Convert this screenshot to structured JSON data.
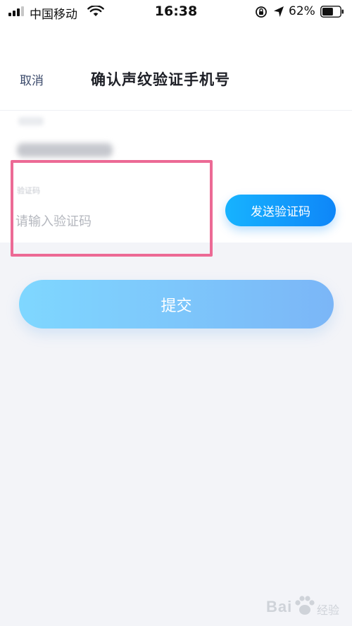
{
  "status_bar": {
    "carrier": "中国移动",
    "time": "16:38",
    "battery_percent": "62%",
    "battery_level": 0.62,
    "icons": [
      "signal-icon",
      "wifi-icon",
      "orientation-lock-icon",
      "location-arrow-icon",
      "battery-icon"
    ]
  },
  "nav": {
    "cancel_label": "取消",
    "title": "确认声纹验证手机号"
  },
  "form": {
    "code_label": "验证码",
    "code_placeholder": "请输入验证码",
    "code_value": "",
    "send_code_label": "发送验证码",
    "submit_label": "提交"
  },
  "watermark": {
    "brand": "Bai",
    "suffix": "经验",
    "icon": "paw-icon"
  },
  "colors": {
    "highlight": "#ec6a95",
    "send_button": "#0e86f8",
    "submit_button": "#7bc4fb",
    "background": "#f3f4f8"
  }
}
